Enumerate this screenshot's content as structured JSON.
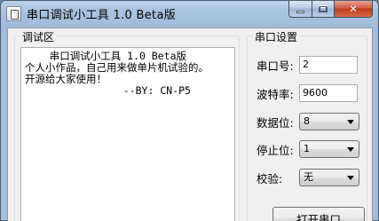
{
  "window": {
    "title": "串口调试小工具 1.0 Beta版",
    "app_icon": "serial-tool-icon"
  },
  "caption_buttons": {
    "minimize_icon": "minimize-icon",
    "maximize_icon": "maximize-icon",
    "close_icon": "close-icon",
    "close_glyph": "✕"
  },
  "debug_area": {
    "group_label": "调试区",
    "lines": [
      "    串口调试小工具 1.0 Beta版",
      "",
      "个人小作品，自己用来做单片机试验的。",
      "开源给大家使用！",
      "                --BY: CN-P5"
    ]
  },
  "serial_settings": {
    "group_label": "串口设置",
    "port": {
      "label": "串口号:",
      "value": "2"
    },
    "baud": {
      "label": "波特率:",
      "value": "9600"
    },
    "data_bits": {
      "label": "数据位:",
      "value": "8"
    },
    "stop_bits": {
      "label": "停止位:",
      "value": "1"
    },
    "parity": {
      "label": "校验:",
      "value": "无"
    },
    "open_button_label": "打开串口"
  }
}
